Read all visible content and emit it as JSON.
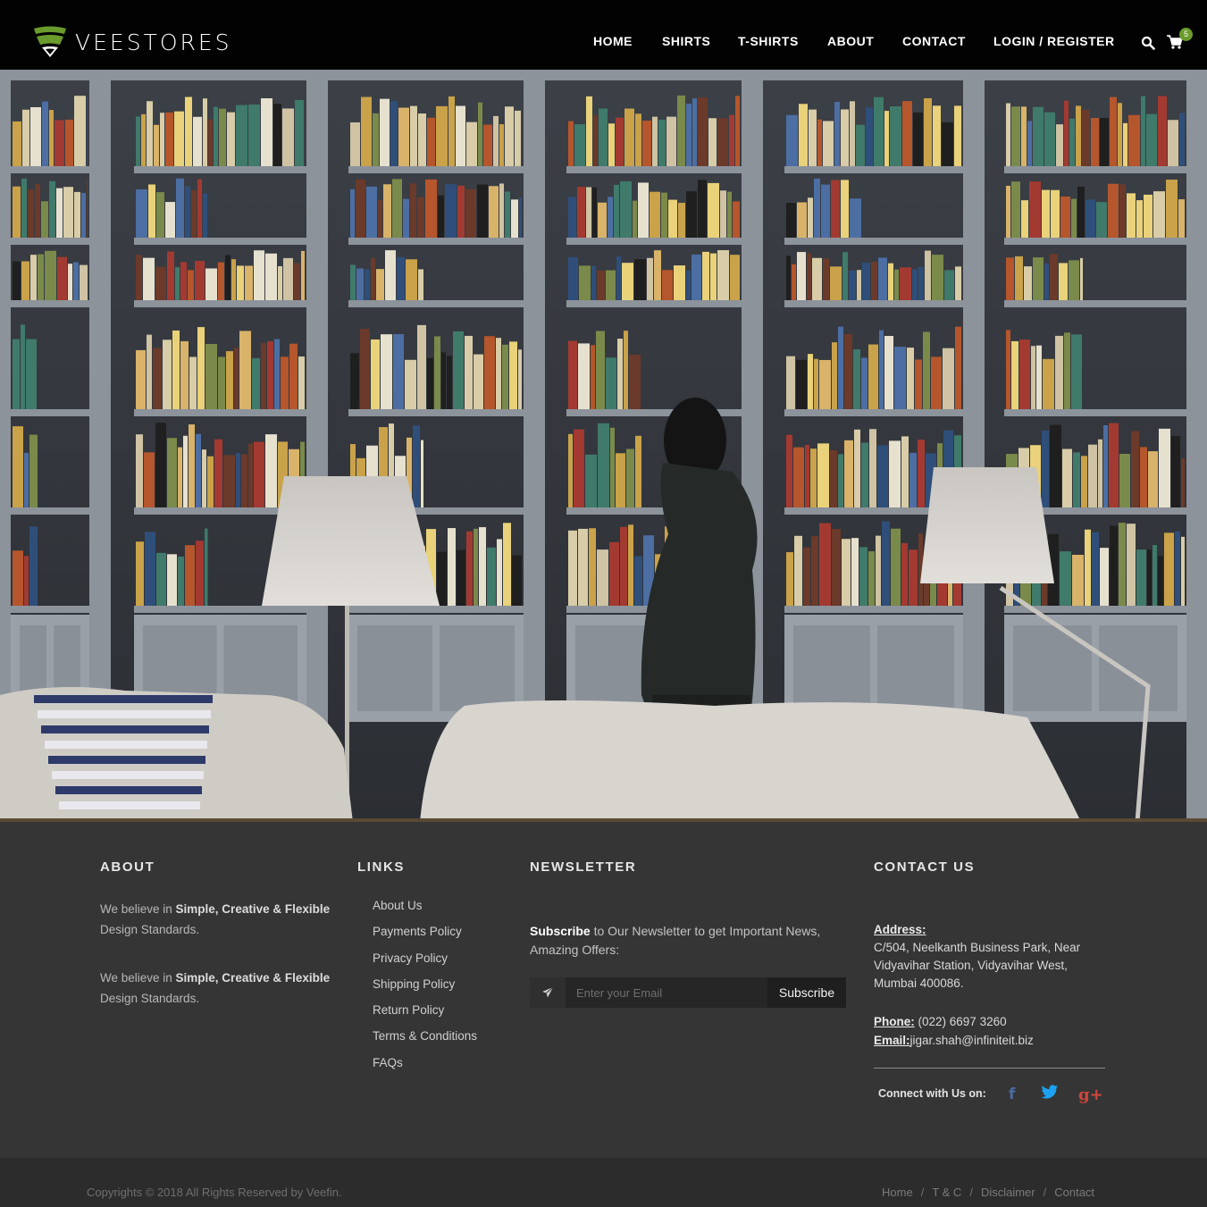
{
  "brand": {
    "name": "VEESTORES",
    "accent_color": "#6a9b2c"
  },
  "nav": {
    "items": [
      {
        "label": "HOME"
      },
      {
        "label": "SHIRTS"
      },
      {
        "label": "T-SHIRTS"
      },
      {
        "label": "ABOUT"
      },
      {
        "label": "CONTACT"
      },
      {
        "label": "LOGIN / REGISTER"
      }
    ],
    "search_icon": "search-icon",
    "cart_icon": "shopping-cart-icon",
    "cart_count": "5"
  },
  "hero": {
    "image": "living room with white bookshelves, lamps, sofa and a woman browsing books"
  },
  "footer": {
    "about": {
      "heading": "ABOUT",
      "paragraphs": [
        {
          "pre": "We believe in ",
          "b1": "Simple, Creative",
          "mid": " & ",
          "b2": "Flexible",
          "post": " Design Standards."
        },
        {
          "pre": "We believe in ",
          "b1": "Simple, Creative",
          "mid": " & ",
          "b2": "Flexible",
          "post": " Design Standards."
        }
      ]
    },
    "links": {
      "heading": "LINKS",
      "items": [
        "About Us",
        "Payments Policy",
        "Privacy Policy",
        "Shipping Policy",
        "Return Policy",
        "Terms & Conditions",
        "FAQs"
      ]
    },
    "newsletter": {
      "heading": "NEWSLETTER",
      "text_bold": "Subscribe",
      "text_rest": " to Our Newsletter to get Important News, Amazing Offers:",
      "input_placeholder": "Enter your Email",
      "input_value": "",
      "button_label": "Subscribe",
      "icon": "paper-plane-icon"
    },
    "contact": {
      "heading": "CONTACT US",
      "address_label": "Address:",
      "address_lines": [
        "C/504, Neelkanth Business Park, Near",
        "Vidyavihar Station, Vidyavihar West,",
        "Mumbai 400086."
      ],
      "phone_label": "Phone:",
      "phone": "(022) 6697 3260",
      "email_label": "Email:",
      "email": "jigar.shah@infiniteit.biz",
      "connect_label": "Connect with Us on:",
      "social": [
        {
          "icon": "facebook-icon",
          "glyph": "f",
          "color": "#4e6aa3"
        },
        {
          "icon": "twitter-icon",
          "color": "#1da1f2"
        },
        {
          "icon": "google-plus-icon",
          "glyph": "g+",
          "color": "#d0473a"
        }
      ]
    }
  },
  "bottom_bar": {
    "copyright": "Copyrights © 2018 All Rights Reserved by Veefin.",
    "links": [
      "Home",
      "T & C",
      "Disclaimer",
      "Contact"
    ],
    "separator": "/"
  }
}
